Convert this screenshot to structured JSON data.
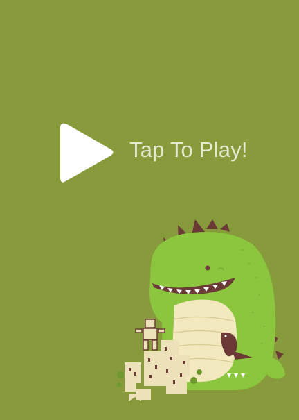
{
  "screen": {
    "background_color": "#889b3c"
  },
  "play": {
    "icon": "play-icon",
    "label": "Tap To Play!"
  },
  "illustration": {
    "icon": "dinosaur-city-illustration"
  },
  "colors": {
    "play_icon": "#ffffff",
    "label_text": "#e3ead0",
    "dino_body": "#8bc63e",
    "dino_belly": "#f2e9be",
    "dino_spikes": "#6b3a36",
    "buildings": "#ede1b9"
  }
}
